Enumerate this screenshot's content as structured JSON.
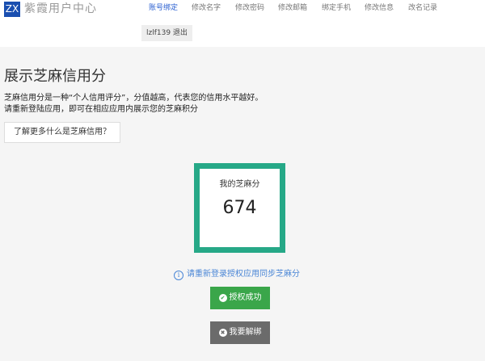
{
  "header": {
    "logo_text": "ZX",
    "brand": "紫霞用户中心",
    "nav": [
      {
        "label": "账号绑定",
        "active": true
      },
      {
        "label": "修改名字",
        "active": false
      },
      {
        "label": "修改密码",
        "active": false
      },
      {
        "label": "修改邮箱",
        "active": false
      },
      {
        "label": "绑定手机",
        "active": false
      },
      {
        "label": "修改信息",
        "active": false
      },
      {
        "label": "改名记录",
        "active": false
      }
    ],
    "user_logout": "lzlf139 退出"
  },
  "main": {
    "title": "展示芝麻信用分",
    "desc_line1": "芝麻信用分是一种“个人信用评分”，分值越高，代表您的信用水平越好。",
    "desc_line2": "请重新登陆应用，即可在相应应用内展示您的芝麻积分",
    "learn_more": "了解更多什么是芝麻信用？",
    "score_label": "我的芝麻分",
    "score_value": "674",
    "sync_hint": "请重新登录授权应用同步芝麻分",
    "success_button": "授权成功",
    "unbind_button": "我要解绑"
  },
  "colors": {
    "accent_blue": "#2a5fd0",
    "score_border": "#26a887",
    "success_green": "#3aa64a",
    "unbind_gray": "#6b6b6b",
    "link_blue": "#4a86d6"
  },
  "icons": {
    "info": "info-circle-icon",
    "check": "check-circle-icon",
    "close": "close-circle-icon"
  }
}
